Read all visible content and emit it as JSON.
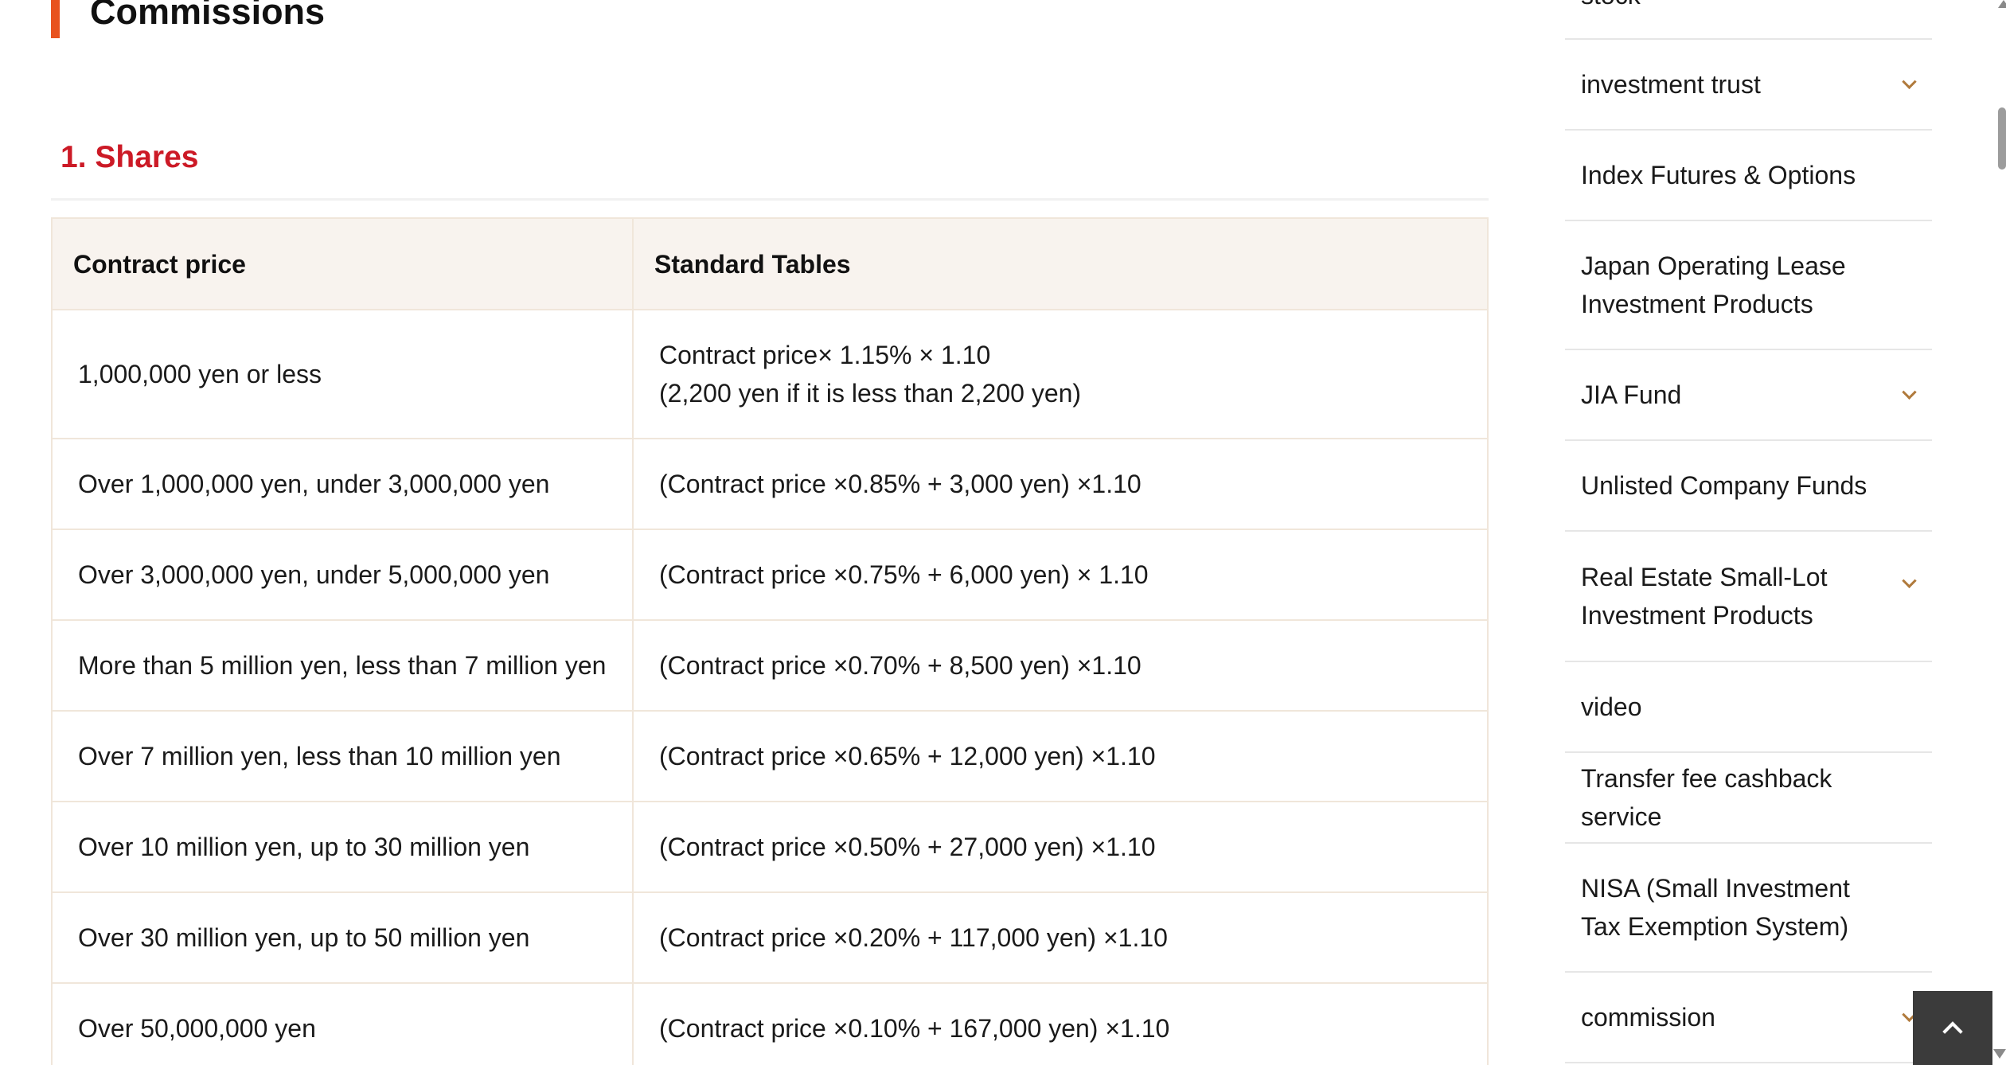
{
  "page": {
    "title": "Commissions",
    "section_heading": "1. Shares"
  },
  "table": {
    "headers": [
      "Contract price",
      "Standard Tables"
    ],
    "rows": [
      {
        "price": "1,000,000 yen or less",
        "fee_line1": "Contract price× 1.15% × 1.10",
        "fee_line2": "(2,200 yen if it is less than 2,200 yen)"
      },
      {
        "price": "Over 1,000,000 yen, under 3,000,000 yen",
        "fee_line1": "(Contract price ×0.85% + 3,000 yen) ×1.10"
      },
      {
        "price": "Over 3,000,000 yen, under 5,000,000 yen",
        "fee_line1": "(Contract price ×0.75% + 6,000 yen) × 1.10"
      },
      {
        "price": "More than 5 million yen, less than 7 million yen",
        "fee_line1": "(Contract price ×0.70% + 8,500 yen) ×1.10"
      },
      {
        "price": "Over 7 million yen, less than 10 million yen",
        "fee_line1": "(Contract price ×0.65% + 12,000 yen) ×1.10"
      },
      {
        "price": "Over 10 million yen, up to 30 million yen",
        "fee_line1": "(Contract price ×0.50% + 27,000 yen) ×1.10"
      },
      {
        "price": "Over 30 million yen, up to 50 million yen",
        "fee_line1": "(Contract price ×0.20% + 117,000 yen) ×1.10"
      },
      {
        "price": "Over 50,000,000 yen",
        "fee_line1": "(Contract price ×0.10% + 167,000 yen) ×1.10"
      }
    ]
  },
  "sidebar": {
    "items": [
      {
        "label": "stock",
        "expandable": true
      },
      {
        "label": "investment trust",
        "expandable": true,
        "icon": "chevron-down-icon"
      },
      {
        "label": "Index Futures & Options",
        "expandable": false
      },
      {
        "label": "Japan Operating Lease Investment Products",
        "expandable": false
      },
      {
        "label": "JIA Fund",
        "expandable": true,
        "icon": "chevron-down-icon"
      },
      {
        "label": "Unlisted Company Funds",
        "expandable": false
      },
      {
        "label": "Real Estate Small-Lot Investment Products",
        "expandable": true,
        "icon": "chevron-down-icon"
      },
      {
        "label": "video",
        "expandable": false
      },
      {
        "label": "Transfer fee cashback service",
        "expandable": false
      },
      {
        "label": "NISA (Small Investment Tax Exemption System)",
        "expandable": false
      },
      {
        "label": "commission",
        "expandable": true,
        "icon": "chevron-down-icon"
      }
    ]
  },
  "back_to_top": {
    "icon": "chevron-up-icon"
  },
  "colors": {
    "accent_bar": "#e8531f",
    "section_heading": "#cc1a26",
    "table_header_bg": "#f8f3ee",
    "table_border": "#f0e6da",
    "chevron": "#b07a3c",
    "back_to_top_bg": "#3b3b3b"
  }
}
